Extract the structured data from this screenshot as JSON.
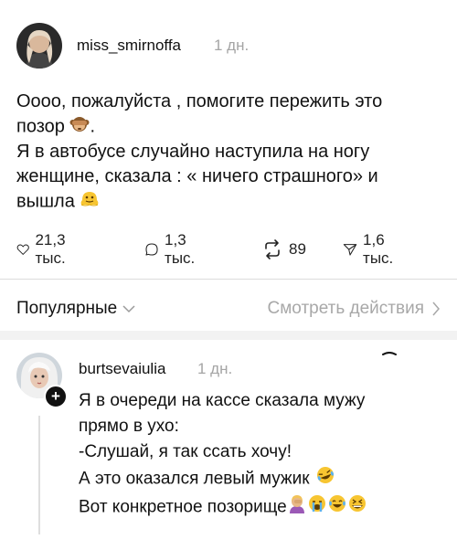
{
  "post": {
    "username": "miss_smirnoffa",
    "time": "1 дн.",
    "lines": [
      "Оооо, пожалуйста , помогите пережить это",
      "позор",
      "Я в автобусе случайно наступила на ногу",
      "женщине, сказала : « ничего страшного» и",
      "вышла"
    ],
    "line2_emoji": "see-no-evil-monkey-icon",
    "line5_emoji": "melting-face-icon"
  },
  "actions": {
    "likes": "21,3 тыс.",
    "replies": "1,3 тыс.",
    "reposts": "89",
    "shares": "1,6 тыс."
  },
  "sort_bar": {
    "sort_label": "Популярные",
    "view_label": "Смотреть действия"
  },
  "comment": {
    "username": "burtsevaiulia",
    "time": "1 дн.",
    "lines": [
      "Я в очереди на кассе сказала мужу",
      "прямо в ухо:",
      "-Слушай, я так ссать хочу!",
      "А это оказался левый мужик",
      "Вот конкретное позорище"
    ],
    "line4_emoji": "rolling-laughing-icon",
    "line5_emojis": [
      "woman-facepalming-icon",
      "loudly-crying-icon",
      "tears-of-joy-icon",
      "grinning-squinting-icon"
    ]
  },
  "colors": {
    "text": "#111111",
    "muted": "#a5a5a5",
    "divider": "#dcdcdc",
    "emoji_yellow": "#f7c531"
  }
}
